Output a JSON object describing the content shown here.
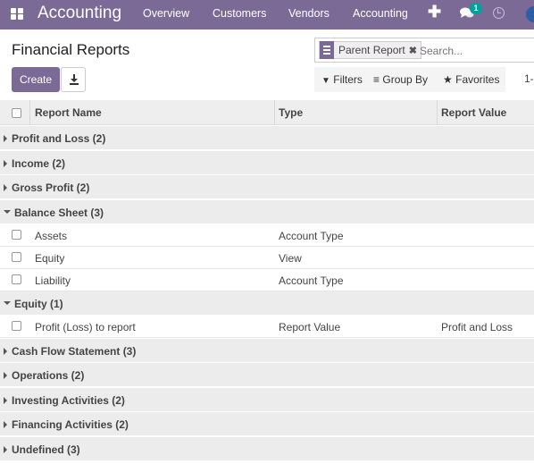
{
  "navbar": {
    "app_title": "Accounting",
    "menu": [
      "Overview",
      "Customers",
      "Vendors",
      "Accounting"
    ],
    "plus": "✚",
    "chat_count": "1"
  },
  "control_panel": {
    "title": "Financial Reports",
    "create_label": "Create",
    "search_facet": "Parent Report",
    "search_placeholder": "Search...",
    "filters_label": "Filters",
    "group_by_label": "Group By",
    "favorites_label": "Favorites",
    "pager": "1-"
  },
  "table": {
    "headers": [
      "Report Name",
      "Type",
      "Report Value"
    ],
    "groups": [
      {
        "label": "Profit and Loss (2)",
        "open": false,
        "rows": []
      },
      {
        "label": "Income (2)",
        "open": false,
        "rows": []
      },
      {
        "label": "Gross Profit (2)",
        "open": false,
        "rows": []
      },
      {
        "label": "Balance Sheet (3)",
        "open": true,
        "rows": [
          {
            "name": "Assets",
            "type": "Account Type",
            "value": ""
          },
          {
            "name": "Equity",
            "type": "View",
            "value": ""
          },
          {
            "name": "Liability",
            "type": "Account Type",
            "value": ""
          }
        ]
      },
      {
        "label": "Equity (1)",
        "open": true,
        "rows": [
          {
            "name": "Profit (Loss) to report",
            "type": "Report Value",
            "value": "Profit and Loss"
          }
        ]
      },
      {
        "label": "Cash Flow Statement (3)",
        "open": false,
        "rows": []
      },
      {
        "label": "Operations (2)",
        "open": false,
        "rows": []
      },
      {
        "label": "Investing Activities (2)",
        "open": false,
        "rows": []
      },
      {
        "label": "Financing Activities (2)",
        "open": false,
        "rows": []
      },
      {
        "label": "Undefined (3)",
        "open": false,
        "rows": []
      }
    ]
  },
  "colors": {
    "brand": "#7c6a96",
    "badge": "#00a09d"
  }
}
